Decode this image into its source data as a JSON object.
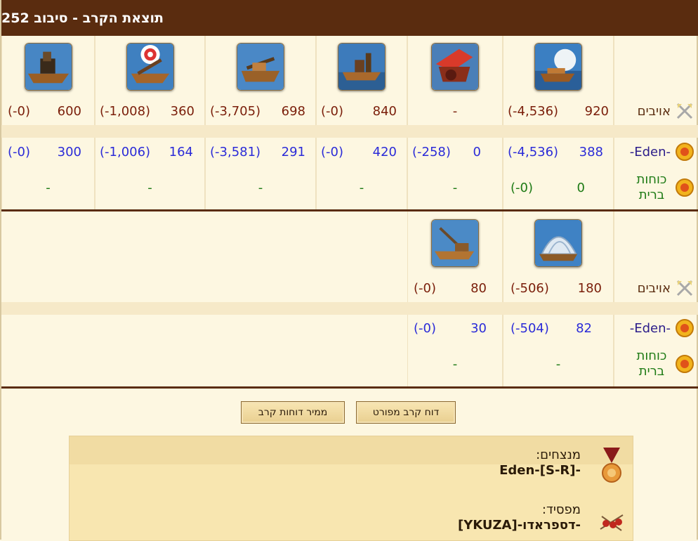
{
  "title": "תוצאת הקרב - סיבוב 252",
  "labels": {
    "enemies": "אויבים",
    "eden": "-Eden-",
    "allied": "כוחות ברית"
  },
  "round1": {
    "units": [
      "ram-ship-icon",
      "flamethrower-ship-icon",
      "steam-ram-ship-icon",
      "ballista-ship-icon",
      "catapult-ship-icon",
      "mortar-ship-icon"
    ],
    "enemies": [
      {
        "v": "920",
        "l": "(-4,536)"
      },
      {
        "v": "-",
        "l": ""
      },
      {
        "v": "840",
        "l": "(-0)"
      },
      {
        "v": "698",
        "l": "(-3,705)"
      },
      {
        "v": "360",
        "l": "(-1,008)"
      },
      {
        "v": "600",
        "l": "(-0)"
      }
    ],
    "eden": [
      {
        "v": "388",
        "l": "(-4,536)"
      },
      {
        "v": "0",
        "l": "(-258)"
      },
      {
        "v": "420",
        "l": "(-0)"
      },
      {
        "v": "291",
        "l": "(-3,581)"
      },
      {
        "v": "164",
        "l": "(-1,006)"
      },
      {
        "v": "300",
        "l": "(-0)"
      }
    ],
    "allied": [
      {
        "v": "0",
        "l": "(-0)"
      },
      {
        "v": "-",
        "l": ""
      },
      {
        "v": "-",
        "l": ""
      },
      {
        "v": "-",
        "l": ""
      },
      {
        "v": "-",
        "l": ""
      },
      {
        "v": "-",
        "l": ""
      }
    ]
  },
  "round2": {
    "units": [
      "paddle-speedboat-icon",
      "crane-ship-icon"
    ],
    "enemies": [
      {
        "v": "180",
        "l": "(-506)"
      },
      {
        "v": "80",
        "l": "(-0)"
      }
    ],
    "eden": [
      {
        "v": "82",
        "l": "(-504)"
      },
      {
        "v": "30",
        "l": "(-0)"
      }
    ],
    "allied": [
      {
        "v": "-",
        "l": ""
      },
      {
        "v": "-",
        "l": ""
      }
    ]
  },
  "buttons": {
    "detailed": "דוח קרב מפורט",
    "converter": "ממיר דוחות קרב"
  },
  "result": {
    "winners_label": "מנצחים:",
    "winners": "-Eden-[S-R]",
    "loser_label": "מפסיד:",
    "loser": "-דספראדו-[YKUZA]"
  },
  "colors": {
    "title_bg": "#5a2c0f",
    "enemy_text": "#7a1e0a",
    "eden_text": "#2b2bd8",
    "allied_text": "#1d7a14"
  }
}
